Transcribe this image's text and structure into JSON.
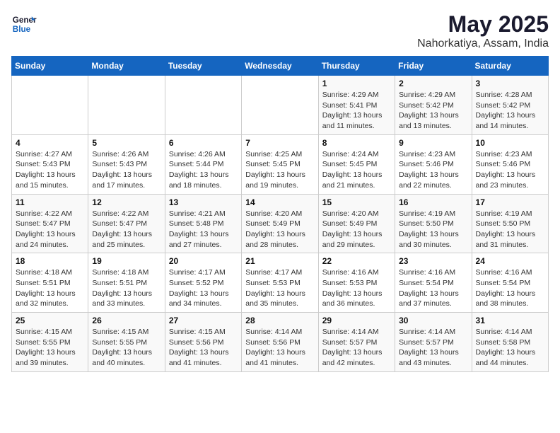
{
  "header": {
    "logo_line1": "General",
    "logo_line2": "Blue",
    "title": "May 2025",
    "subtitle": "Nahorkatiya, Assam, India"
  },
  "weekdays": [
    "Sunday",
    "Monday",
    "Tuesday",
    "Wednesday",
    "Thursday",
    "Friday",
    "Saturday"
  ],
  "weeks": [
    [
      {
        "day": "",
        "info": ""
      },
      {
        "day": "",
        "info": ""
      },
      {
        "day": "",
        "info": ""
      },
      {
        "day": "",
        "info": ""
      },
      {
        "day": "1",
        "info": "Sunrise: 4:29 AM\nSunset: 5:41 PM\nDaylight: 13 hours\nand 11 minutes."
      },
      {
        "day": "2",
        "info": "Sunrise: 4:29 AM\nSunset: 5:42 PM\nDaylight: 13 hours\nand 13 minutes."
      },
      {
        "day": "3",
        "info": "Sunrise: 4:28 AM\nSunset: 5:42 PM\nDaylight: 13 hours\nand 14 minutes."
      }
    ],
    [
      {
        "day": "4",
        "info": "Sunrise: 4:27 AM\nSunset: 5:43 PM\nDaylight: 13 hours\nand 15 minutes."
      },
      {
        "day": "5",
        "info": "Sunrise: 4:26 AM\nSunset: 5:43 PM\nDaylight: 13 hours\nand 17 minutes."
      },
      {
        "day": "6",
        "info": "Sunrise: 4:26 AM\nSunset: 5:44 PM\nDaylight: 13 hours\nand 18 minutes."
      },
      {
        "day": "7",
        "info": "Sunrise: 4:25 AM\nSunset: 5:45 PM\nDaylight: 13 hours\nand 19 minutes."
      },
      {
        "day": "8",
        "info": "Sunrise: 4:24 AM\nSunset: 5:45 PM\nDaylight: 13 hours\nand 21 minutes."
      },
      {
        "day": "9",
        "info": "Sunrise: 4:23 AM\nSunset: 5:46 PM\nDaylight: 13 hours\nand 22 minutes."
      },
      {
        "day": "10",
        "info": "Sunrise: 4:23 AM\nSunset: 5:46 PM\nDaylight: 13 hours\nand 23 minutes."
      }
    ],
    [
      {
        "day": "11",
        "info": "Sunrise: 4:22 AM\nSunset: 5:47 PM\nDaylight: 13 hours\nand 24 minutes."
      },
      {
        "day": "12",
        "info": "Sunrise: 4:22 AM\nSunset: 5:47 PM\nDaylight: 13 hours\nand 25 minutes."
      },
      {
        "day": "13",
        "info": "Sunrise: 4:21 AM\nSunset: 5:48 PM\nDaylight: 13 hours\nand 27 minutes."
      },
      {
        "day": "14",
        "info": "Sunrise: 4:20 AM\nSunset: 5:49 PM\nDaylight: 13 hours\nand 28 minutes."
      },
      {
        "day": "15",
        "info": "Sunrise: 4:20 AM\nSunset: 5:49 PM\nDaylight: 13 hours\nand 29 minutes."
      },
      {
        "day": "16",
        "info": "Sunrise: 4:19 AM\nSunset: 5:50 PM\nDaylight: 13 hours\nand 30 minutes."
      },
      {
        "day": "17",
        "info": "Sunrise: 4:19 AM\nSunset: 5:50 PM\nDaylight: 13 hours\nand 31 minutes."
      }
    ],
    [
      {
        "day": "18",
        "info": "Sunrise: 4:18 AM\nSunset: 5:51 PM\nDaylight: 13 hours\nand 32 minutes."
      },
      {
        "day": "19",
        "info": "Sunrise: 4:18 AM\nSunset: 5:51 PM\nDaylight: 13 hours\nand 33 minutes."
      },
      {
        "day": "20",
        "info": "Sunrise: 4:17 AM\nSunset: 5:52 PM\nDaylight: 13 hours\nand 34 minutes."
      },
      {
        "day": "21",
        "info": "Sunrise: 4:17 AM\nSunset: 5:53 PM\nDaylight: 13 hours\nand 35 minutes."
      },
      {
        "day": "22",
        "info": "Sunrise: 4:16 AM\nSunset: 5:53 PM\nDaylight: 13 hours\nand 36 minutes."
      },
      {
        "day": "23",
        "info": "Sunrise: 4:16 AM\nSunset: 5:54 PM\nDaylight: 13 hours\nand 37 minutes."
      },
      {
        "day": "24",
        "info": "Sunrise: 4:16 AM\nSunset: 5:54 PM\nDaylight: 13 hours\nand 38 minutes."
      }
    ],
    [
      {
        "day": "25",
        "info": "Sunrise: 4:15 AM\nSunset: 5:55 PM\nDaylight: 13 hours\nand 39 minutes."
      },
      {
        "day": "26",
        "info": "Sunrise: 4:15 AM\nSunset: 5:55 PM\nDaylight: 13 hours\nand 40 minutes."
      },
      {
        "day": "27",
        "info": "Sunrise: 4:15 AM\nSunset: 5:56 PM\nDaylight: 13 hours\nand 41 minutes."
      },
      {
        "day": "28",
        "info": "Sunrise: 4:14 AM\nSunset: 5:56 PM\nDaylight: 13 hours\nand 41 minutes."
      },
      {
        "day": "29",
        "info": "Sunrise: 4:14 AM\nSunset: 5:57 PM\nDaylight: 13 hours\nand 42 minutes."
      },
      {
        "day": "30",
        "info": "Sunrise: 4:14 AM\nSunset: 5:57 PM\nDaylight: 13 hours\nand 43 minutes."
      },
      {
        "day": "31",
        "info": "Sunrise: 4:14 AM\nSunset: 5:58 PM\nDaylight: 13 hours\nand 44 minutes."
      }
    ]
  ]
}
